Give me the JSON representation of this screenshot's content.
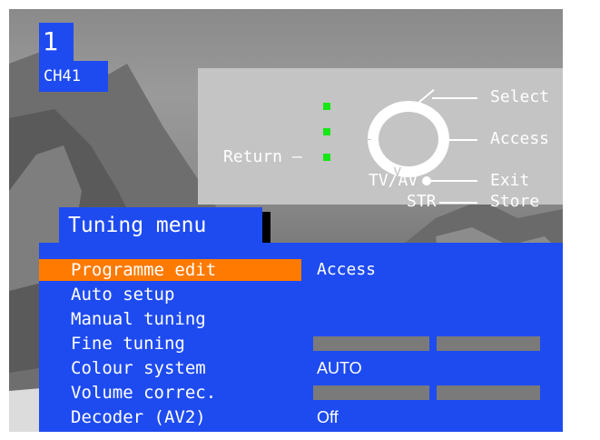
{
  "programme": {
    "number": "1",
    "channel": "CH41"
  },
  "help_panel": {
    "return_label": "Return –",
    "select_label": "Select",
    "access_label": "Access",
    "tvav_label": "TV/AV",
    "str_label": "STR",
    "exit_label": "Exit",
    "store_label": "Store",
    "ring_glyphs": {
      "up": "^",
      "down": "v",
      "minus": "–",
      "plus": "+"
    }
  },
  "menu": {
    "title": "Tuning menu",
    "items": [
      {
        "label": "Programme edit",
        "value": "Access",
        "selected": true,
        "bar": false
      },
      {
        "label": "Auto setup",
        "value": "",
        "selected": false,
        "bar": false
      },
      {
        "label": "Manual tuning",
        "value": "",
        "selected": false,
        "bar": false
      },
      {
        "label": "Fine tuning",
        "value": "",
        "selected": false,
        "bar": true
      },
      {
        "label": "Colour system",
        "value": "AUTO",
        "selected": false,
        "bar": false
      },
      {
        "label": "Volume correc.",
        "value": "",
        "selected": false,
        "bar": true
      },
      {
        "label": "Decoder (AV2)",
        "value": "Off",
        "selected": false,
        "bar": false
      }
    ]
  },
  "colors": {
    "osd_blue": "#1e4bf0",
    "highlight": "#ff7a00",
    "indicator_green": "#15e815",
    "help_panel_grey": "#c4c4c4",
    "slider_grey": "#7a7a7a"
  }
}
